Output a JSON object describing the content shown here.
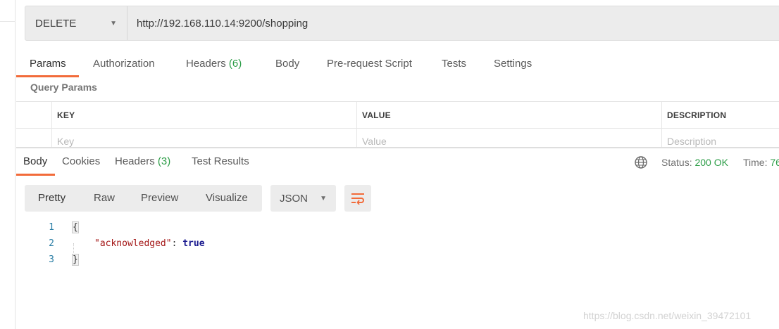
{
  "request": {
    "method": "DELETE",
    "url": "http://192.168.110.14:9200/shopping",
    "tabs": [
      {
        "label": "Params",
        "count": ""
      },
      {
        "label": "Authorization",
        "count": ""
      },
      {
        "label": "Headers",
        "count": "(6)"
      },
      {
        "label": "Body",
        "count": ""
      },
      {
        "label": "Pre-request Script",
        "count": ""
      },
      {
        "label": "Tests",
        "count": ""
      },
      {
        "label": "Settings",
        "count": ""
      }
    ],
    "active_tab": "Params"
  },
  "query_params": {
    "title": "Query Params",
    "columns": [
      "KEY",
      "VALUE",
      "DESCRIPTION"
    ],
    "placeholders": {
      "key": "Key",
      "value": "Value",
      "description": "Description"
    }
  },
  "response": {
    "tabs": [
      {
        "label": "Body",
        "count": ""
      },
      {
        "label": "Cookies",
        "count": ""
      },
      {
        "label": "Headers",
        "count": "(3)"
      },
      {
        "label": "Test Results",
        "count": ""
      }
    ],
    "active_tab": "Body",
    "status_label": "Status:",
    "status_value": "200 OK",
    "time_label": "Time:",
    "time_value": "76",
    "view_modes": [
      "Pretty",
      "Raw",
      "Preview",
      "Visualize"
    ],
    "active_view": "Pretty",
    "format": "JSON",
    "code_lines": [
      {
        "n": "1",
        "text": "{"
      },
      {
        "n": "2",
        "key": "\"acknowledged\"",
        "sep": ": ",
        "value": "true"
      },
      {
        "n": "3",
        "text": "}"
      }
    ]
  },
  "colors": {
    "accent": "#f26b3a",
    "success": "#2c9d47",
    "json_key": "#a31515",
    "json_bool": "#1a1a8f"
  },
  "icons": [
    "caret-down-icon",
    "globe-icon",
    "wrap-lines-icon"
  ],
  "watermark": "https://blog.csdn.net/weixin_39472101"
}
